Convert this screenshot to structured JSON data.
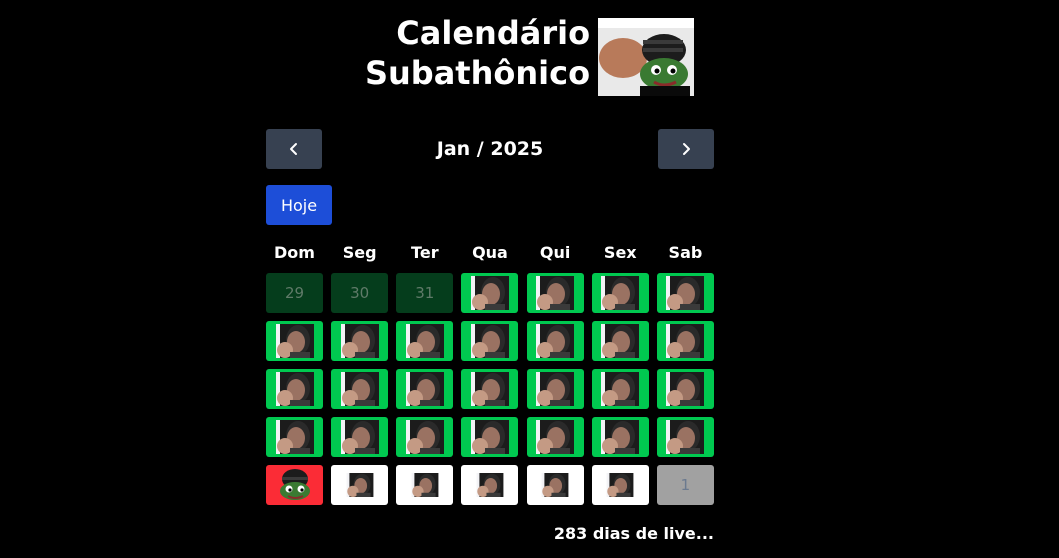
{
  "header": {
    "title_line1": "Calendário",
    "title_line2": "Subathônico",
    "logo_icon": "frog-with-beanie-icon"
  },
  "nav": {
    "prev_icon": "chevron-left-icon",
    "next_icon": "chevron-right-icon",
    "month_label": "Jan / 2025",
    "today_label": "Hoje"
  },
  "weekdays": [
    "Dom",
    "Seg",
    "Ter",
    "Qua",
    "Qui",
    "Sex",
    "Sab"
  ],
  "days": [
    {
      "label": "29",
      "state": "prev"
    },
    {
      "label": "30",
      "state": "prev"
    },
    {
      "label": "31",
      "state": "prev"
    },
    {
      "label": "",
      "state": "live"
    },
    {
      "label": "",
      "state": "live"
    },
    {
      "label": "",
      "state": "live"
    },
    {
      "label": "",
      "state": "live"
    },
    {
      "label": "",
      "state": "live"
    },
    {
      "label": "",
      "state": "live"
    },
    {
      "label": "",
      "state": "live"
    },
    {
      "label": "",
      "state": "live"
    },
    {
      "label": "",
      "state": "live"
    },
    {
      "label": "",
      "state": "live"
    },
    {
      "label": "",
      "state": "live"
    },
    {
      "label": "",
      "state": "live"
    },
    {
      "label": "",
      "state": "live"
    },
    {
      "label": "",
      "state": "live"
    },
    {
      "label": "",
      "state": "live"
    },
    {
      "label": "",
      "state": "live"
    },
    {
      "label": "",
      "state": "live"
    },
    {
      "label": "",
      "state": "live"
    },
    {
      "label": "",
      "state": "live"
    },
    {
      "label": "",
      "state": "live"
    },
    {
      "label": "",
      "state": "live"
    },
    {
      "label": "",
      "state": "live"
    },
    {
      "label": "",
      "state": "live"
    },
    {
      "label": "",
      "state": "live"
    },
    {
      "label": "",
      "state": "live"
    },
    {
      "label": "",
      "state": "today"
    },
    {
      "label": "",
      "state": "future"
    },
    {
      "label": "",
      "state": "future"
    },
    {
      "label": "",
      "state": "future"
    },
    {
      "label": "",
      "state": "future"
    },
    {
      "label": "",
      "state": "future"
    },
    {
      "label": "1",
      "state": "next"
    }
  ],
  "colors": {
    "live": "#00c950",
    "today": "#fb2c36",
    "prev": "#053d1c",
    "next": "#a1a1a1",
    "future": "#ffffff",
    "nav_button": "#374151",
    "today_button": "#1d4ed8"
  },
  "footer": {
    "text": "283 dias de live..."
  }
}
